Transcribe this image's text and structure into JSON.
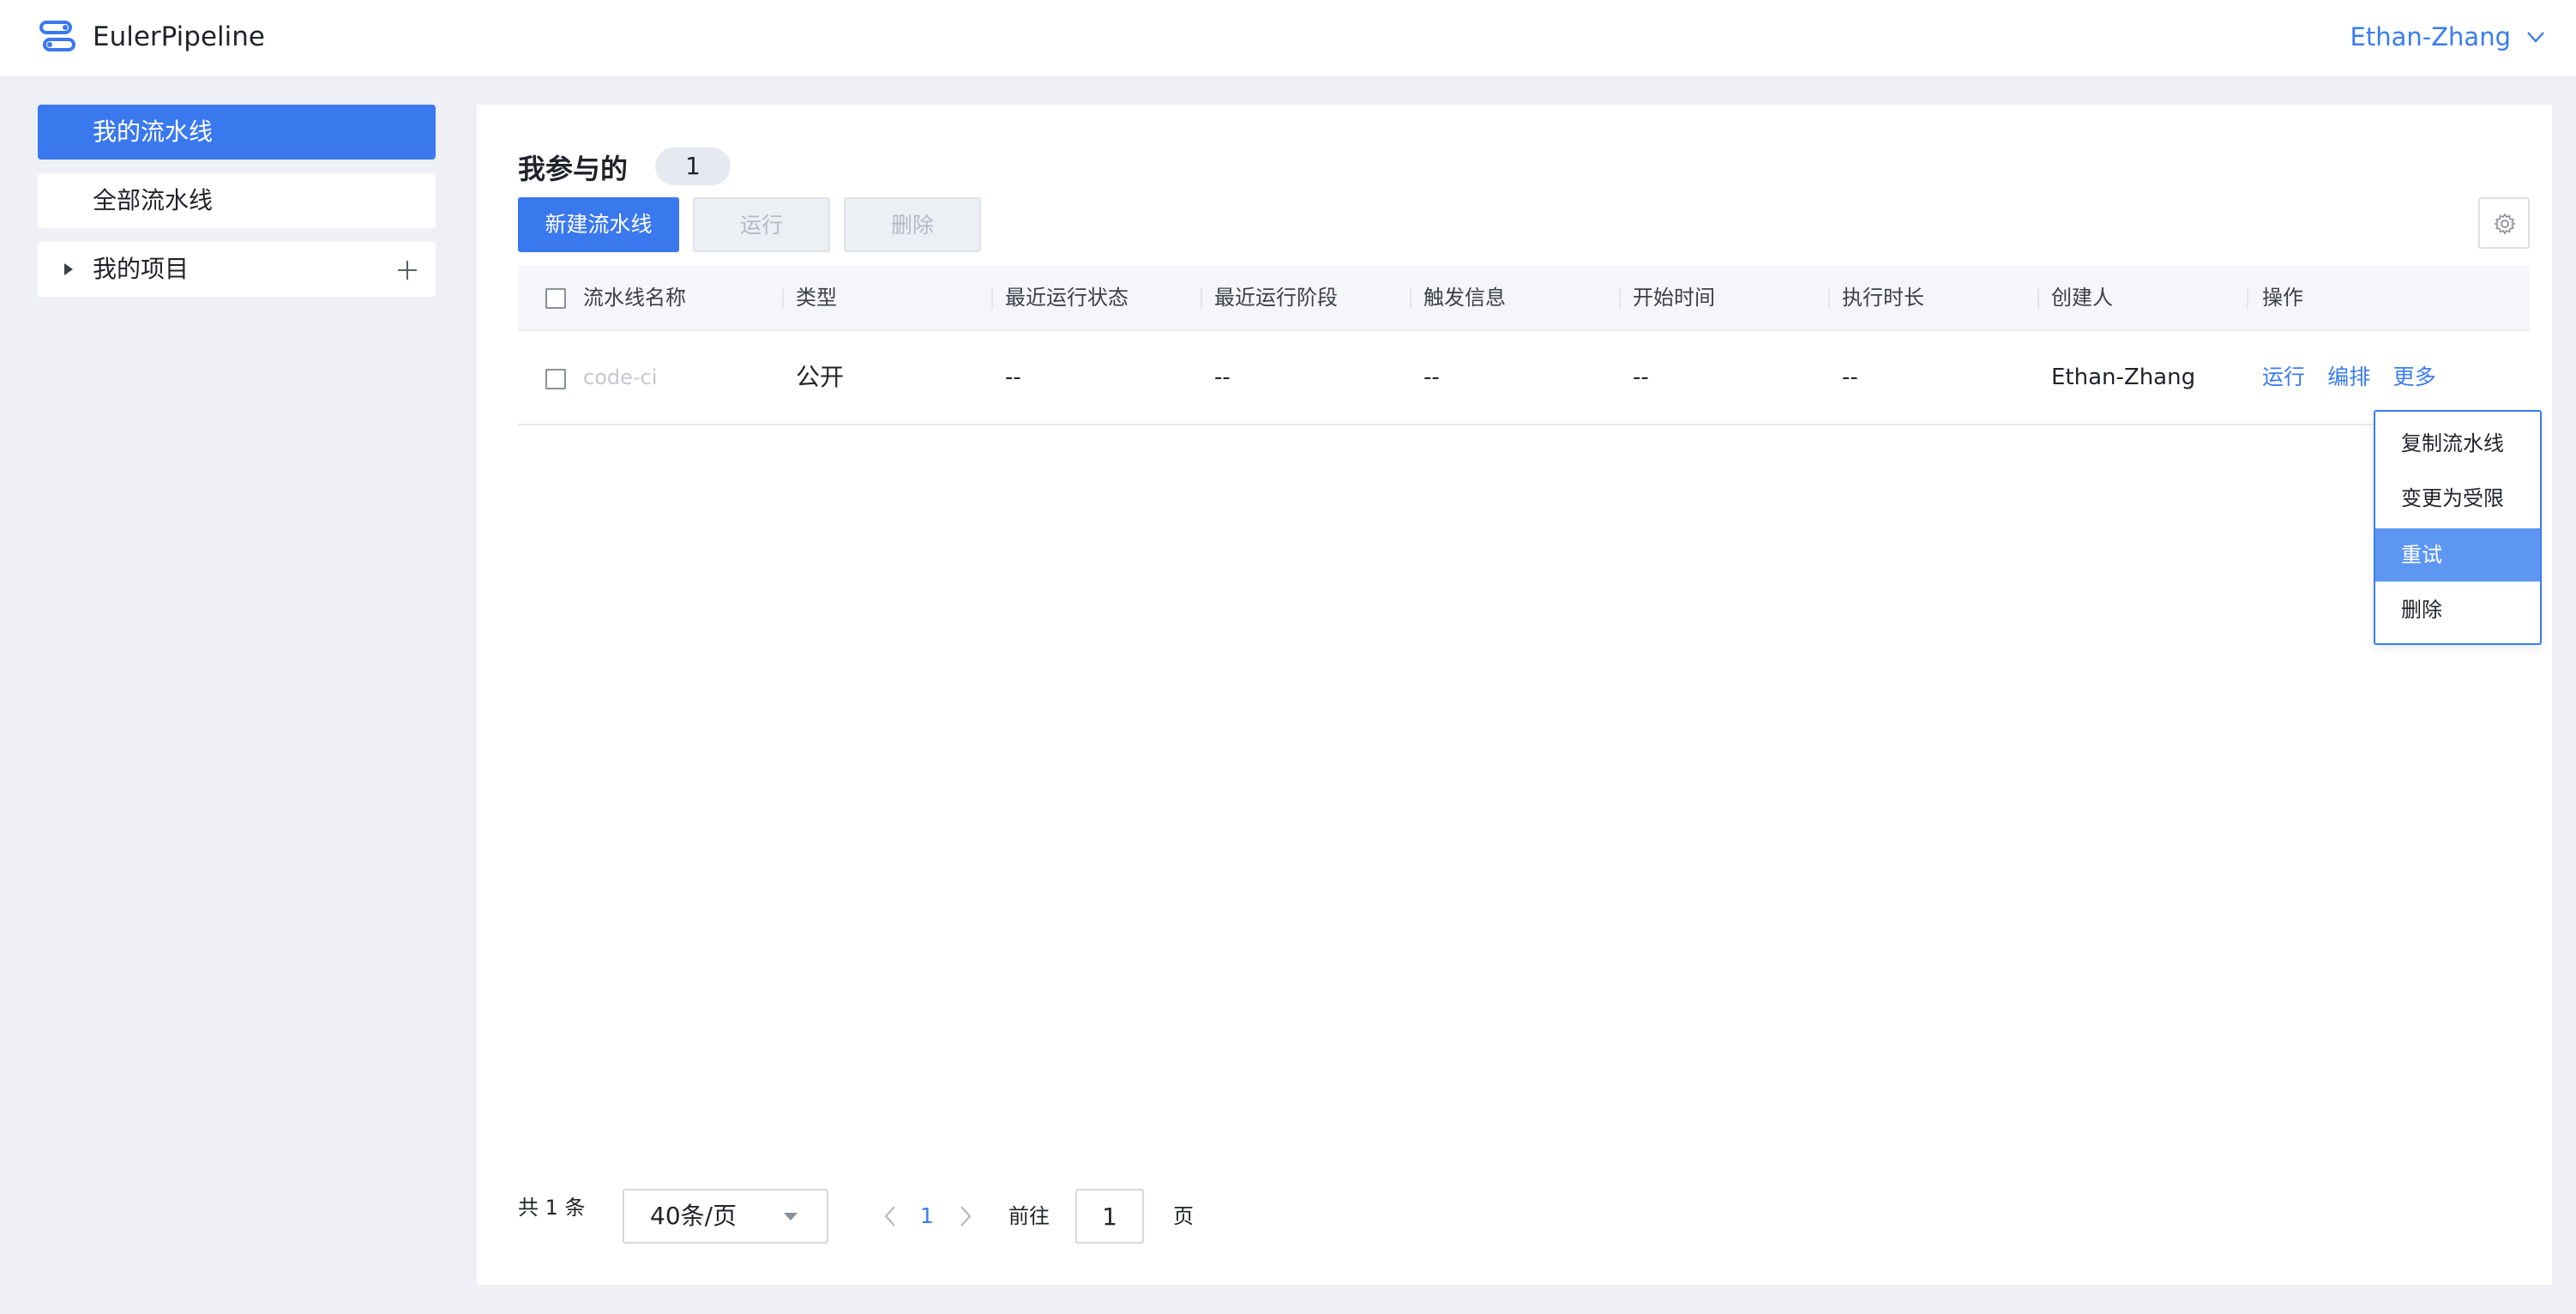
{
  "app": {
    "title": "EulerPipeline",
    "user": "Ethan-Zhang"
  },
  "sidebar": {
    "items": [
      {
        "label": "我的流水线",
        "active": true
      },
      {
        "label": "全部流水线",
        "active": false
      },
      {
        "label": "我的项目",
        "active": false
      }
    ]
  },
  "main": {
    "heading": "我参与的",
    "count": "1",
    "toolbar": {
      "new_label": "新建流水线",
      "run_label": "运行",
      "delete_label": "删除"
    },
    "table": {
      "columns": [
        "流水线名称",
        "类型",
        "最近运行状态",
        "最近运行阶段",
        "触发信息",
        "开始时间",
        "执行时长",
        "创建人",
        "操作"
      ],
      "rows": [
        {
          "name": "code-ci",
          "type": "公开",
          "last_status": "--",
          "last_stage": "--",
          "trigger": "--",
          "start_time": "--",
          "duration": "--",
          "creator": "Ethan-Zhang",
          "actions": [
            "运行",
            "编排",
            "更多"
          ]
        }
      ]
    },
    "more_menu": {
      "items": [
        "复制流水线",
        "变更为受限",
        "重试",
        "删除"
      ],
      "highlighted": "重试"
    },
    "pagination": {
      "total": "共 1 条",
      "page_size": "40条/页",
      "current_page": "1",
      "goto_label": "前往",
      "goto_value": "1",
      "goto_suffix": "页"
    }
  },
  "colors": {
    "primary": "#3a78ee",
    "link": "#3a7cf0",
    "highlight": "#5d97f2",
    "background": "#eef0f6"
  }
}
